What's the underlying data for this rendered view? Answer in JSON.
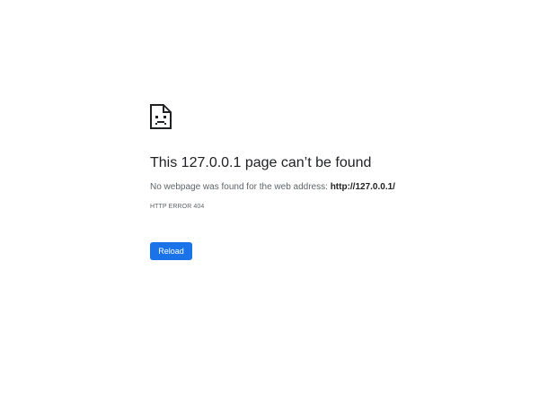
{
  "error": {
    "icon": "sad-document-icon",
    "title": "This 127.0.0.1 page can’t be found",
    "description_prefix": "No webpage was found for the web address: ",
    "address": "http://127.0.0.1/",
    "code": "HTTP ERROR 404"
  },
  "actions": {
    "reload_label": "Reload"
  },
  "colors": {
    "title": "#202124",
    "text": "#5f6368",
    "button_background": "#1a73e8",
    "button_text": "#ffffff",
    "background": "#ffffff"
  }
}
